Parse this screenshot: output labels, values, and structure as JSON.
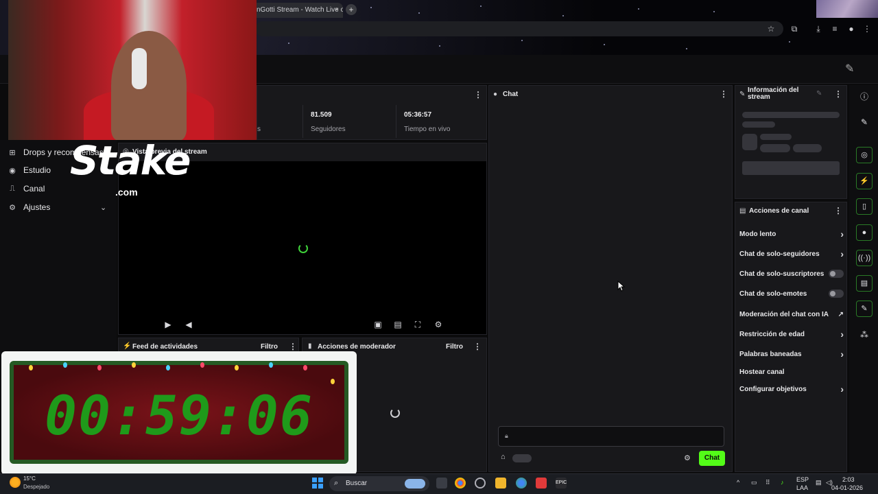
{
  "browser": {
    "tab_title": "nGotti Stream - Watch Live o",
    "tab_close": "×",
    "new_tab": "+"
  },
  "sidebar": {
    "items": [
      {
        "label": "Drops y recompensas",
        "icon": "gift-icon"
      },
      {
        "label": "Estudio",
        "icon": "studio-icon"
      },
      {
        "label": "Canal",
        "icon": "channel-icon"
      },
      {
        "label": "Ajustes",
        "icon": "gear-icon"
      }
    ],
    "ajustes_chevron": "⌄"
  },
  "overlay": {
    "stake_logo": "Stake",
    "stake_domain": ".com",
    "timer": "00:59:06"
  },
  "stats": {
    "partial_label": "s",
    "followers_value": "81.509",
    "followers_label": "Seguidores",
    "live_value": "05:36:57",
    "live_label": "Tiempo en vivo"
  },
  "preview": {
    "title": "Vista previa del stream"
  },
  "feed": {
    "title": "Feed de actividades",
    "filter": "Filtro"
  },
  "moderator": {
    "title": "Acciones de moderador",
    "filter": "Filtro"
  },
  "chat": {
    "title": "Chat",
    "send_label": "Chat"
  },
  "info": {
    "title": "Información del stream"
  },
  "channel_actions": {
    "title": "Acciones de canal",
    "items": [
      {
        "label": "Modo lento",
        "control": "chevron"
      },
      {
        "label": "Chat de solo-seguidores",
        "control": "chevron"
      },
      {
        "label": "Chat de solo-suscriptores",
        "control": "toggle",
        "on": false
      },
      {
        "label": "Chat de solo-emotes",
        "control": "toggle",
        "on": false
      },
      {
        "label": "Moderación del chat con IA",
        "control": "external"
      },
      {
        "label": "Restricción de edad",
        "control": "chevron"
      },
      {
        "label": "Palabras baneadas",
        "control": "chevron"
      },
      {
        "label": "Hostear canal",
        "control": "none"
      },
      {
        "label": "Configurar objetivos",
        "control": "chevron"
      }
    ]
  },
  "taskbar": {
    "temperature": "15°C",
    "weather": "Despejado",
    "search": "Buscar",
    "lang_top": "ESP",
    "lang_bottom": "LAA",
    "time": "2:03",
    "date": "04-01-2026"
  },
  "colors": {
    "accent": "#53fc18",
    "panel": "#18181b",
    "background": "#0b0b0c"
  }
}
